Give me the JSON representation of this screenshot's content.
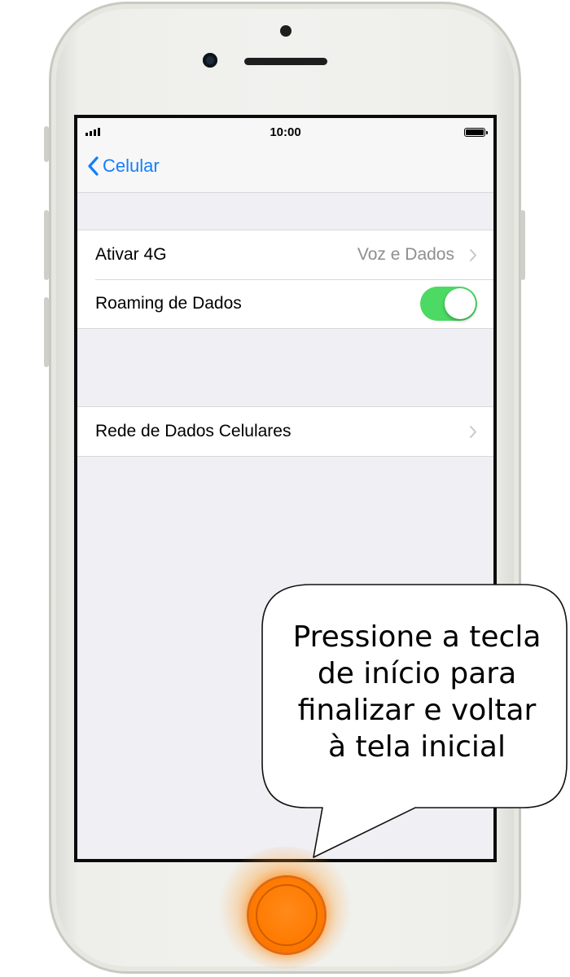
{
  "status_bar": {
    "time": "10:00",
    "signal_icon": "signal-bars-icon",
    "battery_icon": "battery-full-icon"
  },
  "nav": {
    "back_label": "Celular",
    "back_icon": "chevron-left-icon"
  },
  "settings": {
    "group1": [
      {
        "label": "Ativar 4G",
        "value": "Voz e Dados",
        "icon": "chevron-right-icon"
      },
      {
        "label": "Roaming de Dados",
        "toggle_on": true
      }
    ],
    "group2": [
      {
        "label": "Rede de Dados Celulares",
        "icon": "chevron-right-icon"
      }
    ]
  },
  "callout": {
    "lines": [
      "Pressione a tecla",
      "de início para",
      "finalizar e voltar",
      "à tela inicial"
    ]
  },
  "colors": {
    "accent": "#157efb",
    "toggle_on": "#4cd964",
    "home_highlight": "#ff7a00",
    "screen_background": "#efeff4"
  }
}
